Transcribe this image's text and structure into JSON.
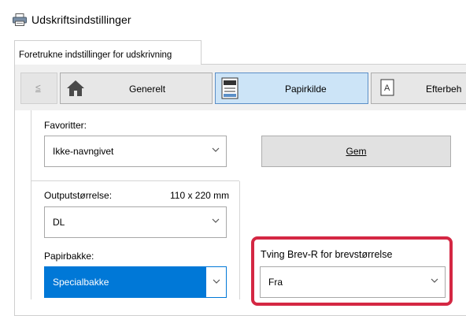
{
  "window": {
    "title": "Udskriftsindstillinger",
    "title_icon": "printer-icon"
  },
  "tabs": [
    {
      "label": "Foretrukne indstillinger for udskrivning"
    }
  ],
  "toolbar": {
    "back_label": "≤",
    "items": [
      {
        "label": "Generelt",
        "icon": "home-icon"
      },
      {
        "label": "Papirkilde",
        "icon": "paper-source-icon",
        "selected": true
      },
      {
        "label": "Efterbeh",
        "icon": "finishing-icon"
      }
    ]
  },
  "favorites": {
    "label": "Favoritter:",
    "value": "Ikke-navngivet",
    "save_label": "Gem"
  },
  "output_size": {
    "label": "Outputstørrelse:",
    "dimension": "110 x 220 mm",
    "value": "DL"
  },
  "paper_tray": {
    "label": "Papirbakke:",
    "value": "Specialbakke"
  },
  "force_letter": {
    "label": "Tving Brev-R for brevstørrelse",
    "value": "Fra"
  },
  "colors": {
    "accent": "#0078d7",
    "highlight": "#d42743",
    "selected_tab": "#cce4f7"
  }
}
